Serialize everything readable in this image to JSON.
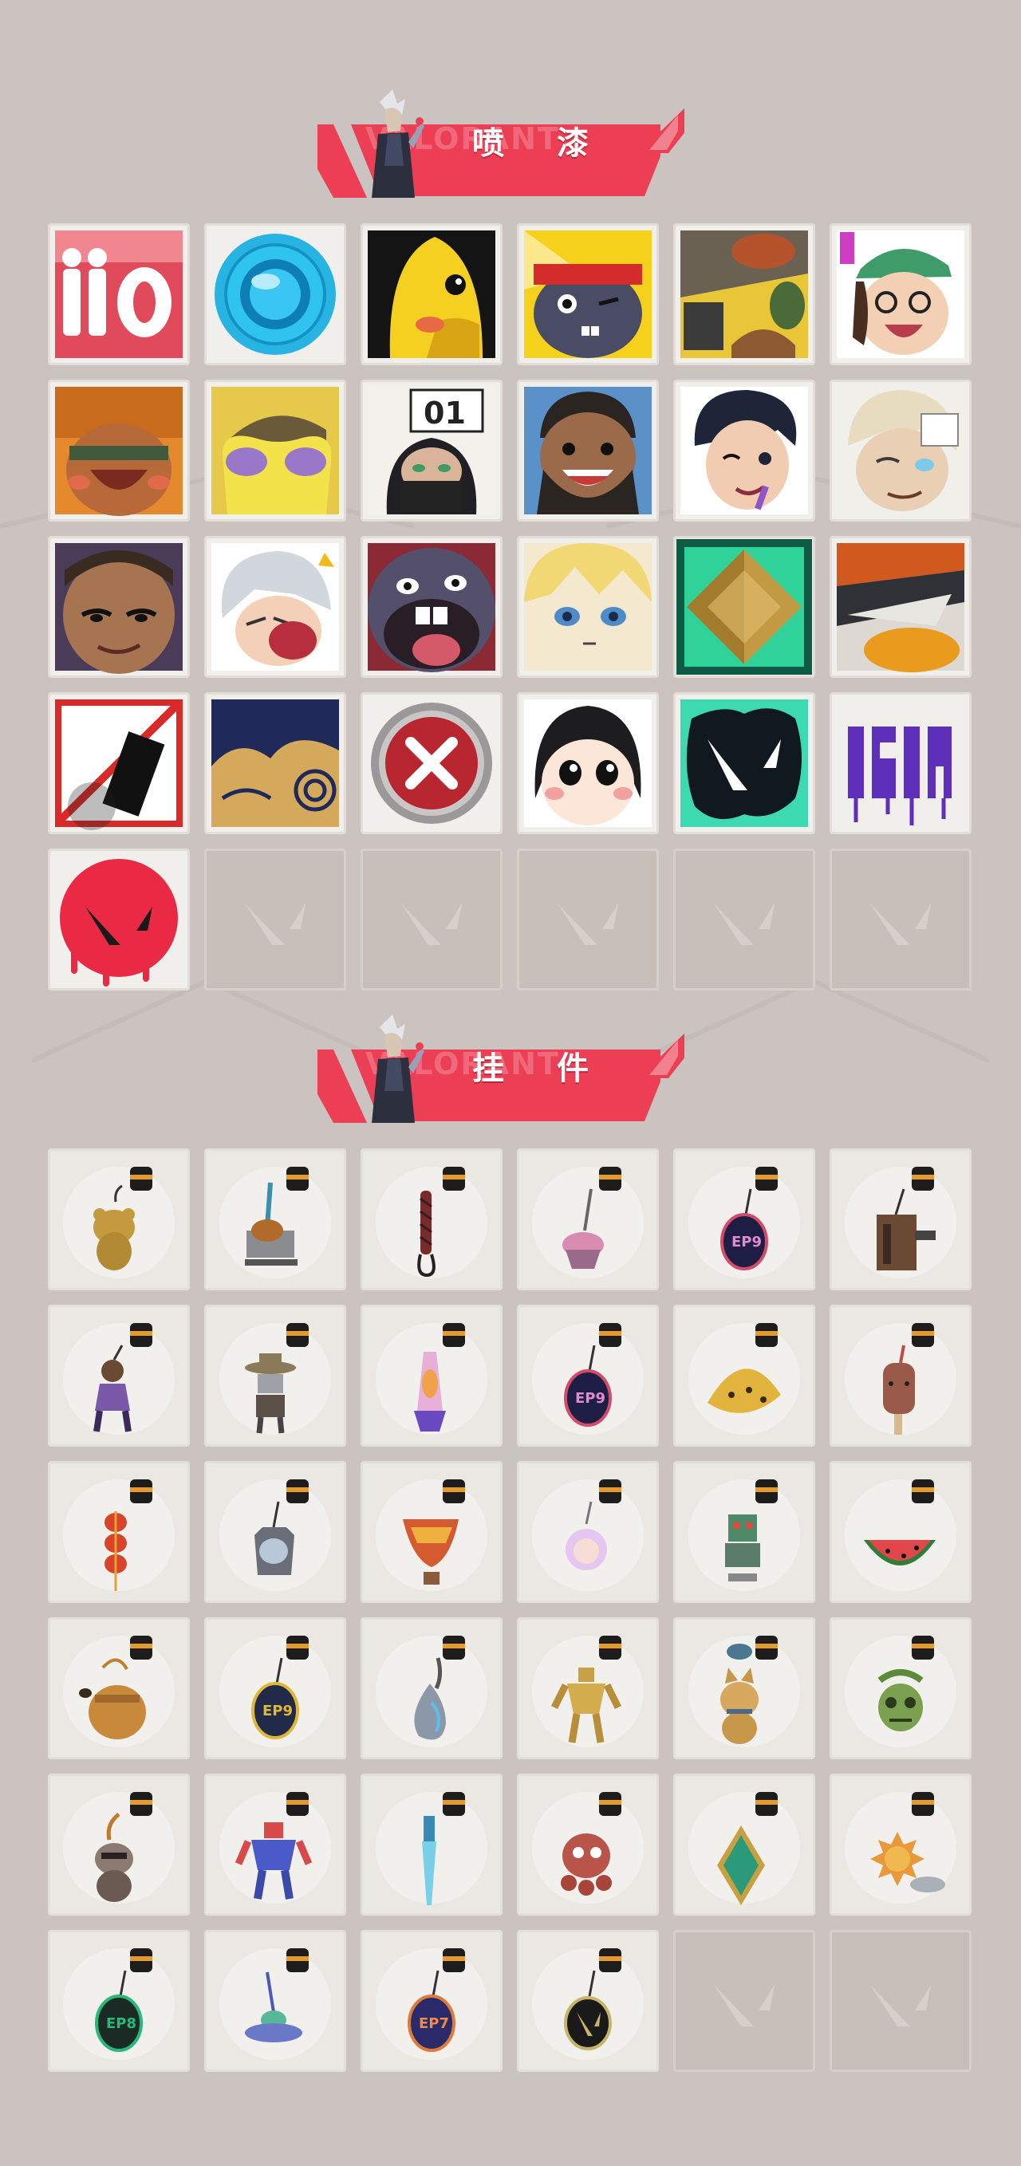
{
  "accent_color": "#ec3f55",
  "background_color": "#cbc3bf",
  "sections": {
    "sprays": {
      "title": "喷 漆",
      "watermark": "VALORANT",
      "icon": "agent-avatar-icon",
      "items": [
        {
          "icon": "number-10-spray-icon"
        },
        {
          "icon": "blue-orb-spray-icon"
        },
        {
          "icon": "yellow-creature-spray-icon"
        },
        {
          "icon": "bandana-bunny-spray-icon"
        },
        {
          "icon": "grenade-hand-spray-icon"
        },
        {
          "icon": "laughing-agent-spray-icon"
        },
        {
          "icon": "laughing-masked-agent-spray-icon"
        },
        {
          "icon": "purple-blob-hat-spray-icon"
        },
        {
          "icon": "masked-agent-01-spray-icon"
        },
        {
          "icon": "bearded-agent-spray-icon"
        },
        {
          "icon": "winking-agent-spray-icon"
        },
        {
          "icon": "bandaged-agent-spray-icon"
        },
        {
          "icon": "smug-agent-spray-icon"
        },
        {
          "icon": "crying-agent-spray-icon"
        },
        {
          "icon": "screaming-creature-spray-icon"
        },
        {
          "icon": "blonde-agent-spray-icon"
        },
        {
          "icon": "gold-emblem-spray-icon"
        },
        {
          "icon": "duck-spray-icon"
        },
        {
          "icon": "no-spray-sign-icon"
        },
        {
          "icon": "golden-clouds-spray-icon"
        },
        {
          "icon": "red-x-button-spray-icon"
        },
        {
          "icon": "pouting-girl-spray-icon"
        },
        {
          "icon": "valorant-splat-spray-icon"
        },
        {
          "icon": "graffiti-tag-spray-icon"
        },
        {
          "icon": "red-valorant-drip-spray-icon"
        },
        {
          "icon": "empty-slot-icon"
        },
        {
          "icon": "empty-slot-icon"
        },
        {
          "icon": "empty-slot-icon"
        },
        {
          "icon": "empty-slot-icon"
        },
        {
          "icon": "empty-slot-icon"
        }
      ]
    },
    "charms": {
      "title": "挂 件",
      "watermark": "VALORANT",
      "icon": "agent-avatar-icon",
      "items": [
        {
          "icon": "gold-bear-charm-icon"
        },
        {
          "icon": "shopping-cart-charm-icon"
        },
        {
          "icon": "braided-cord-charm-icon"
        },
        {
          "icon": "cupcake-charm-icon"
        },
        {
          "icon": "ep9-medallion-charm-icon"
        },
        {
          "icon": "wooden-crate-charm-icon"
        },
        {
          "icon": "agent-figure-charm-icon"
        },
        {
          "icon": "cowboy-robot-charm-icon"
        },
        {
          "icon": "lava-lamp-charm-icon"
        },
        {
          "icon": "ep9-medallion-charm-icon"
        },
        {
          "icon": "banana-slice-charm-icon"
        },
        {
          "icon": "popsicle-charm-icon"
        },
        {
          "icon": "red-lantern-charm-icon"
        },
        {
          "icon": "cat-tag-charm-icon"
        },
        {
          "icon": "hot-air-balloon-charm-icon"
        },
        {
          "icon": "anime-girl-charm-icon"
        },
        {
          "icon": "robot-charm-icon"
        },
        {
          "icon": "watermelon-charm-icon"
        },
        {
          "icon": "honey-pot-charm-icon"
        },
        {
          "icon": "ep9-medallion-charm-icon"
        },
        {
          "icon": "silver-drop-charm-icon"
        },
        {
          "icon": "gold-mech-charm-icon"
        },
        {
          "icon": "fox-pup-charm-icon"
        },
        {
          "icon": "green-skull-charm-icon"
        },
        {
          "icon": "raccoon-charm-icon"
        },
        {
          "icon": "mecha-hero-charm-icon"
        },
        {
          "icon": "blue-blade-charm-icon"
        },
        {
          "icon": "octopus-charm-icon"
        },
        {
          "icon": "green-crystal-charm-icon"
        },
        {
          "icon": "sunflower-charm-icon"
        },
        {
          "icon": "ep8-medallion-charm-icon"
        },
        {
          "icon": "ufo-charm-icon"
        },
        {
          "icon": "ep7-medallion-charm-icon"
        },
        {
          "icon": "valorant-coin-charm-icon"
        },
        {
          "icon": "empty-slot-icon"
        },
        {
          "icon": "empty-slot-icon"
        }
      ]
    }
  }
}
